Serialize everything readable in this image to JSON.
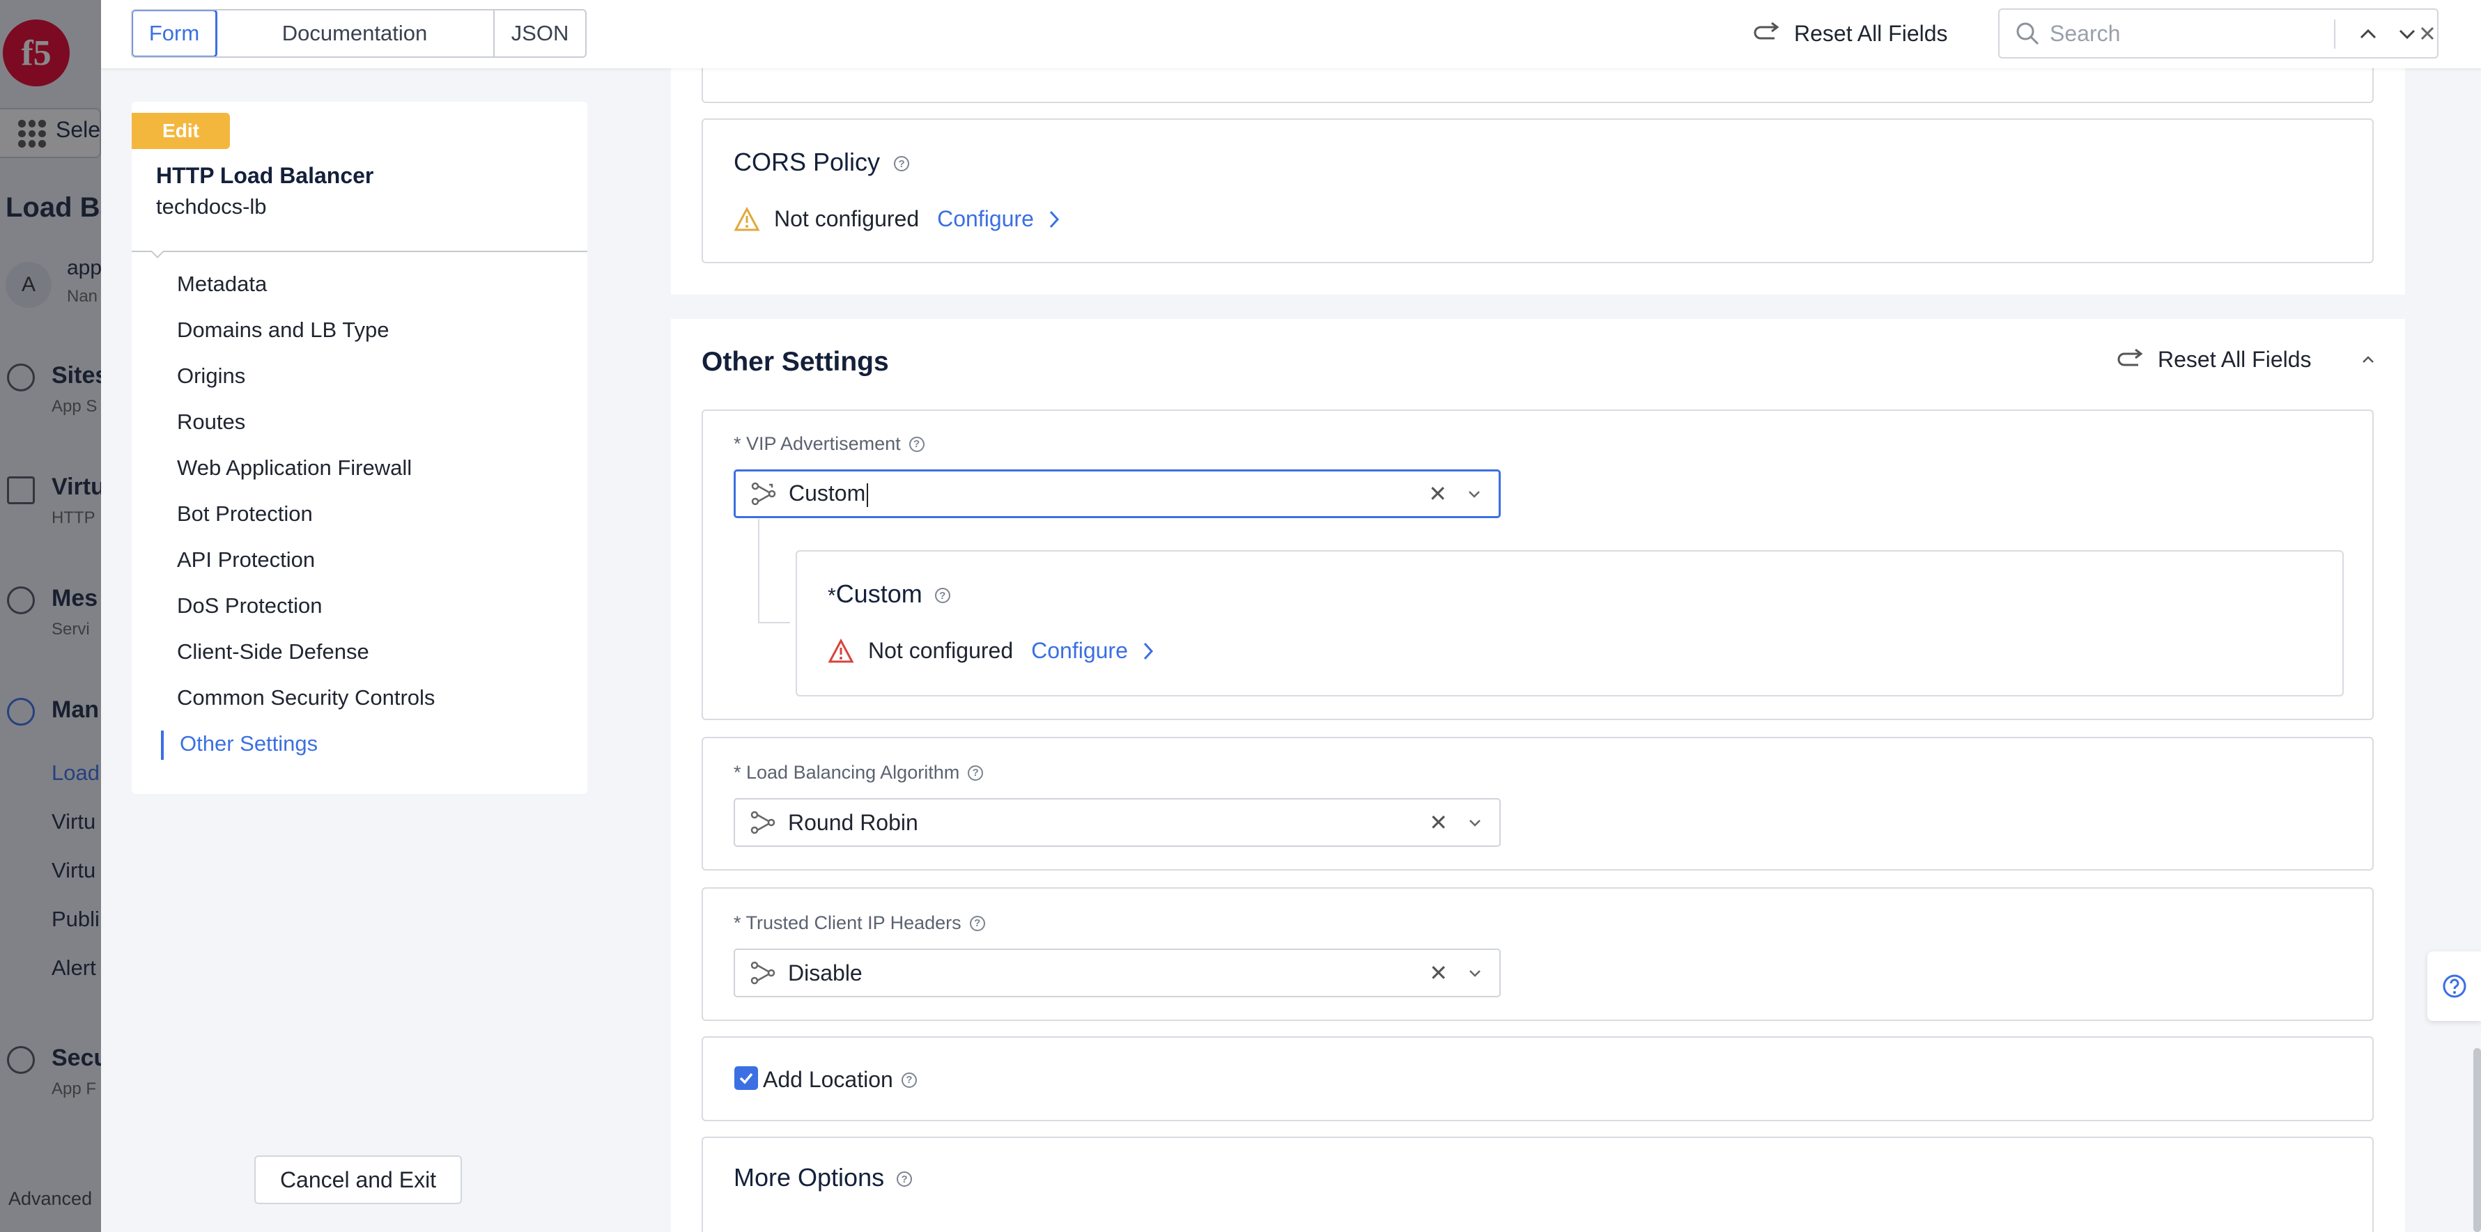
{
  "colors": {
    "accent": "#3b6fe3",
    "edit_tag": "#f4b73e",
    "warning": "#e2a93b",
    "error": "#d9443b",
    "brand_red": "#e4002b"
  },
  "background_app": {
    "logo": "f5",
    "select_label": "Sele",
    "page_title": "Load Ba",
    "avatar_letter": "A",
    "avatar_name": "app",
    "avatar_sub": "Nan",
    "items": [
      {
        "label": "Sites",
        "sub": "App S"
      },
      {
        "label": "Virtu",
        "sub": "HTTP"
      },
      {
        "label": "Mes",
        "sub": "Servi"
      },
      {
        "label": "Man",
        "sub": ""
      }
    ],
    "sub_items": [
      "Load",
      "Virtu",
      "Virtu",
      "Publi",
      "Alert"
    ],
    "security": {
      "label": "Secu",
      "sub": "App F"
    },
    "advanced": "Advanced"
  },
  "topbar": {
    "tabs": [
      {
        "label": "Form",
        "active": true
      },
      {
        "label": "Documentation"
      },
      {
        "label": "JSON"
      }
    ],
    "reset_all": "Reset All Fields",
    "search_placeholder": "Search"
  },
  "nav": {
    "edit_tag": "Edit",
    "title": "HTTP Load Balancer",
    "subtitle": "techdocs-lb",
    "items": [
      "Metadata",
      "Domains and LB Type",
      "Origins",
      "Routes",
      "Web Application Firewall",
      "Bot Protection",
      "API Protection",
      "DoS Protection",
      "Client-Side Defense",
      "Common Security Controls",
      "Other Settings"
    ],
    "active_item": "Other Settings",
    "cancel": "Cancel and Exit"
  },
  "cors": {
    "title": "CORS Policy",
    "status": "Not configured",
    "configure": "Configure"
  },
  "other_settings": {
    "title": "Other Settings",
    "reset_all": "Reset All Fields",
    "vip": {
      "label": "* VIP Advertisement",
      "value": "Custom",
      "custom": {
        "title": "Custom",
        "required_mark": "*",
        "status": "Not configured",
        "configure": "Configure"
      }
    },
    "lb_algorithm": {
      "label": "* Load Balancing Algorithm",
      "value": "Round Robin"
    },
    "trusted_ip": {
      "label": "* Trusted Client IP Headers",
      "value": "Disable"
    },
    "add_location": {
      "label": "Add Location",
      "checked": true
    },
    "more_options": {
      "title": "More Options"
    }
  }
}
